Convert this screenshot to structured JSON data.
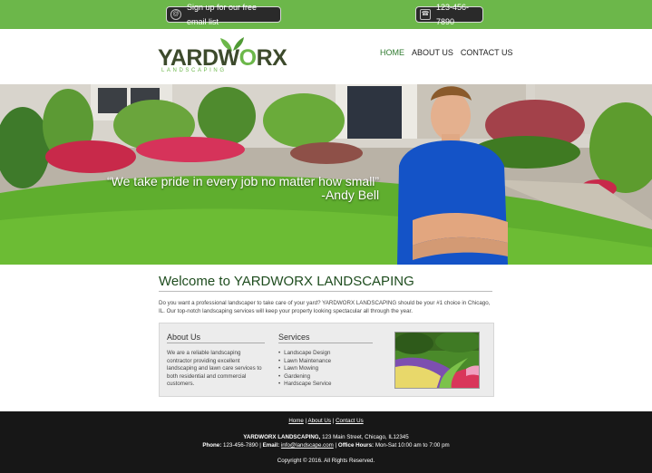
{
  "topbar": {
    "signup_label": "Sign up for our free email list",
    "signup_icon": "at-sign-icon",
    "phone_label": "123-456-7890",
    "phone_icon": "phone-icon"
  },
  "header": {
    "logo_text_a": "YARDW",
    "logo_text_o": "O",
    "logo_text_b": "RX",
    "logo_sub": "LANDSCAPING",
    "nav": [
      "HOME",
      "ABOUT US",
      "CONTACT US"
    ]
  },
  "hero": {
    "quote": "“We take pride in every job no matter how small”",
    "author": "-Andy Bell"
  },
  "main": {
    "title": "Welcome to YARDWORX LANDSCAPING",
    "intro": "Do you want a professional landscaper to take care of your yard? YARDWORX LANDSCAPING should be your #1 choice in Chicago, IL. Our top-notch landscaping services will keep your property looking spectacular all through the year."
  },
  "about": {
    "heading": "About Us",
    "text": "We are a reliable landscaping contractor providing excellent landscaping and lawn care services to both residential and commercial customers."
  },
  "services": {
    "heading": "Services",
    "items": [
      "Landscape Design",
      "Lawn Maintenance",
      "Lawn Mowing",
      "Gardening",
      "Hardscape Service"
    ]
  },
  "footer": {
    "links": [
      "Home",
      "About Us",
      "Contact Us"
    ],
    "company": "YARDWORX LANDSCAPING,",
    "address": "123 Main Street, Chicago, IL12345",
    "phone_label": "Phone:",
    "phone": "123-456-7890",
    "email_label": "Email:",
    "email": "info@landscape.com",
    "hours_label": "Office Hours:",
    "hours": "Mon-Sat 10:00 am to 7:00 pm",
    "copyright": "Copyright © 2016. All Rights Reserved."
  },
  "colors": {
    "brand_green": "#6cb74a",
    "dark_green": "#1f4d1f",
    "footer_bg": "#171717"
  }
}
